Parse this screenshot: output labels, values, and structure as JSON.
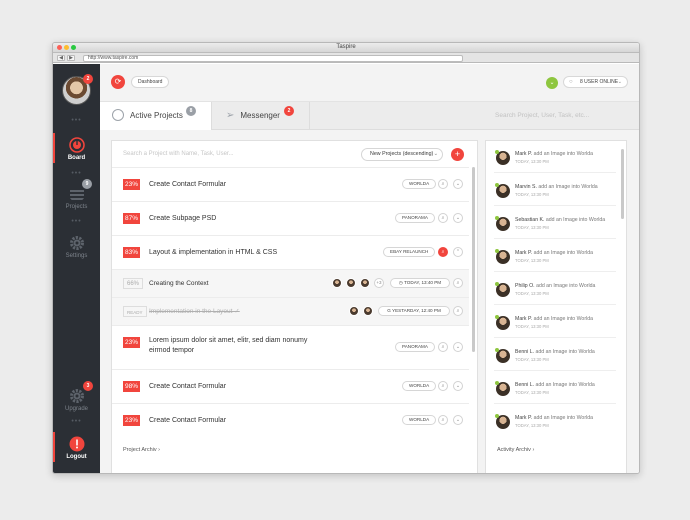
{
  "window": {
    "title": "Taspire",
    "url": "http://www.taspire.com"
  },
  "colors": {
    "accent": "#f1453d",
    "sidebar": "#2b2f35",
    "online": "#8ec63f"
  },
  "sidebar": {
    "avatar_badge": "2",
    "items": [
      {
        "label": "Board",
        "icon": "gauge-icon",
        "active": true
      },
      {
        "label": "Projects",
        "icon": "stack-icon",
        "badge": "9"
      },
      {
        "label": "Settings",
        "icon": "gear-icon"
      },
      {
        "label": "Upgrade",
        "icon": "gear-icon",
        "badge": "3"
      },
      {
        "label": "Logout",
        "icon": "power-icon"
      }
    ]
  },
  "topbar": {
    "breadcrumb": "Dashboard",
    "online_label": "8 USER ONLINE"
  },
  "tabs": [
    {
      "label": "Active Projects",
      "badge": "8",
      "icon": "clock-icon"
    },
    {
      "label": "Messenger",
      "badge": "2",
      "icon": "paper-plane-icon"
    }
  ],
  "tab_search_placeholder": "Search Project, User, Task, etc...",
  "projects": {
    "search_placeholder": "Search a Project with Name, Task, User...",
    "sort_label": "New Projects",
    "sort_suffix": "(descending)",
    "add_label": "+",
    "rows": [
      {
        "pct": "23%",
        "title": "Create Contact Formular",
        "tag": "WORLDA"
      },
      {
        "pct": "87%",
        "title": "Create Subpage PSD",
        "tag": "PANORAMA"
      },
      {
        "pct": "83%",
        "title": "Layout & implementation in HTML & CSS",
        "tag": "EBAY RELAUNCH"
      },
      {
        "pct": "66%",
        "title": "Creating the Context",
        "extra": "+3",
        "date": "TODAY, 13:40 PM"
      },
      {
        "pct": "READY",
        "title": "Implementation in the Layout ✓",
        "date": "YESTARDAY, 12:40 PM"
      },
      {
        "pct": "23%",
        "title": "Lorem ipsum dolor sit amet, elitr, sed diam nonumy eirmod tempor",
        "tag": "PANORAMA"
      },
      {
        "pct": "98%",
        "title": "Create Contact Formular",
        "tag": "WORLDA"
      },
      {
        "pct": "23%",
        "title": "Create Contact Formular",
        "tag": "WORLDA"
      }
    ],
    "footer": "Project Archiv  ›"
  },
  "activity": {
    "items": [
      {
        "name": "Mark P.",
        "text": "add an Image into Worlda",
        "time": "TODAY, 13:30 PM"
      },
      {
        "name": "Marvin S.",
        "text": "add an Image into Worlda",
        "time": "TODAY, 13:30 PM"
      },
      {
        "name": "Sebastian K.",
        "text": "add an Image into Worlda",
        "time": "TODAY, 13:30 PM"
      },
      {
        "name": "Mark P.",
        "text": "add an Image into Worlda",
        "time": "TODAY, 13:30 PM"
      },
      {
        "name": "Philip O.",
        "text": "add an Image into Worlda",
        "time": "TODAY, 13:30 PM"
      },
      {
        "name": "Mark P.",
        "text": "add an Image into Worlda",
        "time": "TODAY, 13:30 PM"
      },
      {
        "name": "Benni L.",
        "text": "add an Image into Worlda",
        "time": "TODAY, 13:30 PM"
      },
      {
        "name": "Benni L.",
        "text": "add an Image into Worlda",
        "time": "TODAY, 13:30 PM"
      },
      {
        "name": "Mark P.",
        "text": "add an Image into Worlda",
        "time": "TODAY, 13:30 PM"
      }
    ],
    "footer": "Activity Archiv  ›"
  }
}
